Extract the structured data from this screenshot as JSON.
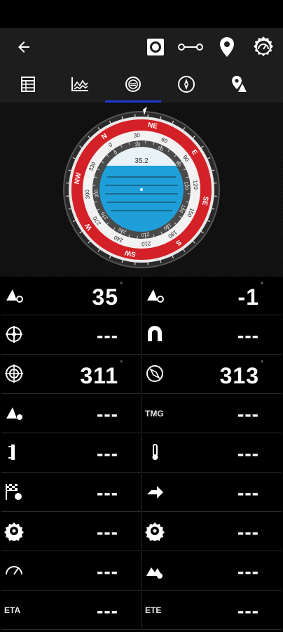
{
  "toolbar": {
    "back_icon": "arrow-left-icon",
    "actions": [
      "record-icon",
      "route-icon",
      "location-pin-icon",
      "gauge-settings-icon"
    ]
  },
  "tabs": [
    {
      "icon": "table-icon"
    },
    {
      "icon": "chart-icon"
    },
    {
      "icon": "compass-dial-icon",
      "active": true
    },
    {
      "icon": "compass-icon"
    },
    {
      "icon": "waypoint-icon"
    }
  ],
  "compass": {
    "bearing": "35.2",
    "cardinals": [
      "NW",
      "N",
      "NE",
      "E",
      "SE",
      "S",
      "SW",
      "W"
    ],
    "outer_ticks": [
      "330",
      "0",
      "30",
      "60",
      "90",
      "120",
      "150",
      "180",
      "210",
      "240",
      "270",
      "300"
    ],
    "inner_ticks": [
      "0",
      "30",
      "60",
      "90",
      "120",
      "150",
      "180",
      "210",
      "240",
      "270",
      "300"
    ],
    "accent": "#d42027",
    "water": "#1e9fd9"
  },
  "cells": [
    {
      "icon": "boat-heading-icon",
      "value": "35",
      "unit": "°"
    },
    {
      "icon": "boat-heading-icon",
      "value": "-1",
      "unit": "°"
    },
    {
      "icon": "crosshair-icon",
      "value": "---"
    },
    {
      "icon": "magnet-icon",
      "value": "---"
    },
    {
      "icon": "target-icon",
      "value": "311",
      "unit": "°"
    },
    {
      "icon": "compass-needle-icon",
      "value": "313",
      "unit": "°"
    },
    {
      "icon": "boat-speed-icon",
      "value": "---"
    },
    {
      "label": "TMG",
      "value": "---"
    },
    {
      "icon": "depth-icon",
      "value": "---"
    },
    {
      "icon": "thermometer-icon",
      "value": "---"
    },
    {
      "icon": "finish-flag-icon",
      "value": "---"
    },
    {
      "icon": "arrow-right-icon",
      "value": "---"
    },
    {
      "icon": "gear-icon",
      "value": "---"
    },
    {
      "icon": "gear-icon",
      "value": "---"
    },
    {
      "icon": "speedometer-icon",
      "value": "---"
    },
    {
      "icon": "wave-icon",
      "value": "---"
    },
    {
      "label": "ETA",
      "value": "---"
    },
    {
      "label": "ETE",
      "value": "---"
    }
  ]
}
